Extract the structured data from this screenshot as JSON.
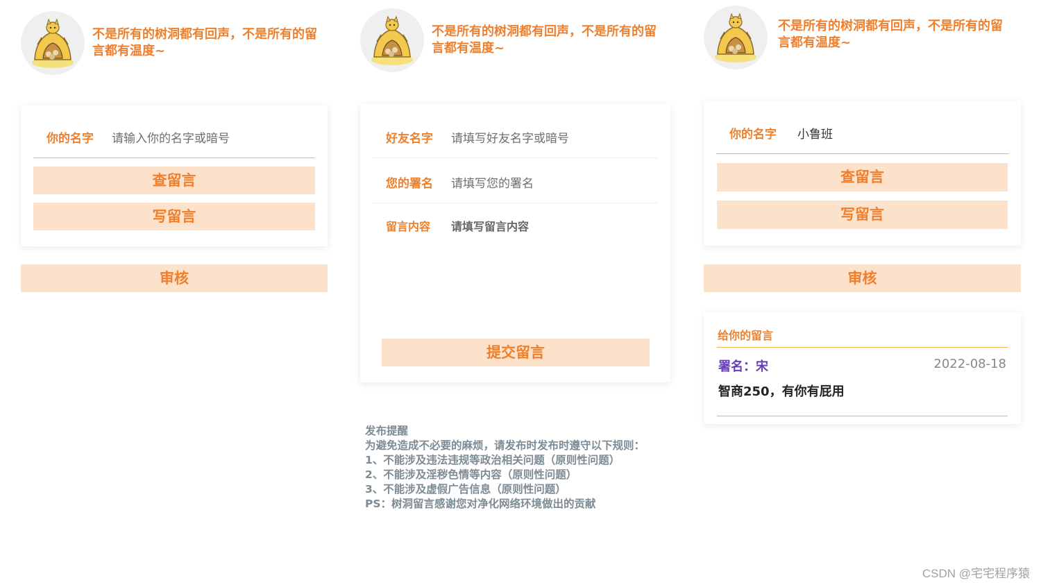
{
  "header": {
    "slogan": "不是所有的树洞都有回声，不是所有的留言都有温度~"
  },
  "check_panel": {
    "name_label": "你的名字",
    "name_placeholder": "请输入你的名字或暗号",
    "view_button": "查留言",
    "write_button": "写留言",
    "review_button": "审核"
  },
  "write_panel": {
    "friend_label": "好友名字",
    "friend_placeholder": "请填写好友名字或暗号",
    "signature_label": "您的署名",
    "signature_placeholder": "请填写您的署名",
    "content_label": "留言内容",
    "content_placeholder": "请填写留言内容",
    "submit_button": "提交留言"
  },
  "notice": {
    "title": "发布提醒",
    "intro": "为避免造成不必要的麻烦，请发布时发布时遵守以下规则：",
    "rules": [
      "1、不能涉及违法违规等政治相关问题（原则性问题）",
      "2、不能涉及淫秽色情等内容（原则性问题）",
      "3、不能涉及虚假广告信息（原则性问题）"
    ],
    "ps": "PS：树洞留言感谢您对净化网络环境做出的贡献"
  },
  "result_panel": {
    "name_label": "你的名字",
    "name_value": "小鲁班",
    "view_button": "查留言",
    "write_button": "写留言",
    "review_button": "审核",
    "message_card": {
      "title": "给你的留言",
      "signature": "署名：宋",
      "date": "2022-08-18",
      "content": "智商250，有你有屁用"
    }
  },
  "watermark": "CSDN @宅宅程序猿",
  "colors": {
    "accent": "#ee7f2d",
    "button_bg": "#fde2cb",
    "divider": "#f2b545",
    "signature": "#6a3db8"
  }
}
